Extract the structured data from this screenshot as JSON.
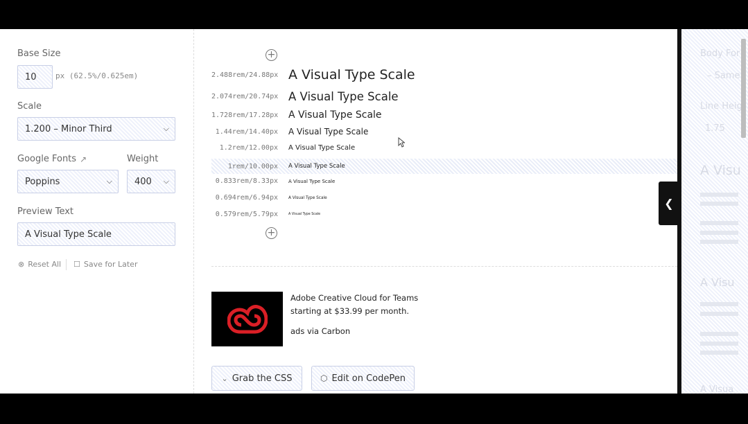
{
  "controls": {
    "base_size_label": "Base Size",
    "base_size_value": "10",
    "base_size_hint": "px (62.5%/0.625em)",
    "scale_label": "Scale",
    "scale_value": "1.200 – Minor Third",
    "google_fonts_label": "Google Fonts",
    "weight_label": "Weight",
    "font_value": "Poppins",
    "weight_value": "400",
    "preview_text_label": "Preview Text",
    "preview_text_value": "A Visual Type Scale",
    "reset_label": "Reset All",
    "save_label": "Save for Later"
  },
  "scale": {
    "rows": [
      {
        "size": "2.488rem/24.88px",
        "text": "A Visual Type Scale"
      },
      {
        "size": "2.074rem/20.74px",
        "text": "A Visual Type Scale"
      },
      {
        "size": "1.728rem/17.28px",
        "text": "A Visual Type Scale"
      },
      {
        "size": "1.44rem/14.40px",
        "text": "A Visual Type Scale"
      },
      {
        "size": "1.2rem/12.00px",
        "text": "A Visual Type Scale"
      },
      {
        "size": "1rem/10.00px",
        "text": "A Visual Type Scale"
      },
      {
        "size": "0.833rem/8.33px",
        "text": "A Visual Type Scale"
      },
      {
        "size": "0.694rem/6.94px",
        "text": "A Visual Type Scale"
      },
      {
        "size": "0.579rem/5.79px",
        "text": "A Visual Type Scale"
      }
    ]
  },
  "ad": {
    "line1": "Adobe Creative Cloud for Teams",
    "line2": "starting at $33.99 per month.",
    "via": "ads via Carbon"
  },
  "actions": {
    "grab_css": "Grab the CSS",
    "edit_codepen": "Edit on CodePen"
  },
  "right_panel": {
    "body_font_label": "Body For",
    "same_label": "– Same",
    "line_height_label": "Line Heig",
    "line_height_value": "1.75",
    "heading_1": "A Visu",
    "heading_2": "A Visu",
    "heading_3": "A Visua"
  },
  "colors": {
    "accent_field_border": "#c8cfe6",
    "adobe_red": "#da1f26"
  }
}
